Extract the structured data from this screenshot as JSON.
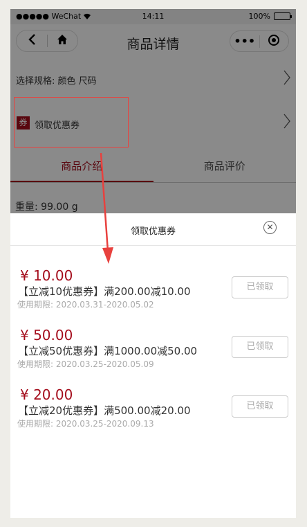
{
  "status_bar": {
    "carrier": "●●●●● WeChat",
    "time": "14:11",
    "battery": "100%",
    "battery_level": 1.0
  },
  "nav": {
    "title": "商品详情",
    "back_icon": "back-chevron-icon",
    "home_icon": "home-icon",
    "more_icon": "more-dots-icon",
    "close_icon": "target-close-icon"
  },
  "page": {
    "spec_label": "选择规格: 颜色 尺码",
    "coupon_tag": "券",
    "coupon_label": "领取优惠券",
    "tabs": [
      {
        "label": "商品介绍",
        "active": true
      },
      {
        "label": "商品评价",
        "active": false
      }
    ],
    "weight": "重量: 99.00 g"
  },
  "sheet": {
    "title": "领取优惠券",
    "coupons": [
      {
        "amount": "¥ 10.00",
        "name": "【立减10优惠券】满200.00减10.00",
        "date": "使用期限: 2020.03.31-2020.05.02",
        "button": "已领取"
      },
      {
        "amount": "¥ 50.00",
        "name": "【立减50优惠券】满1000.00减50.00",
        "date": "使用期限: 2020.03.25-2020.05.09",
        "button": "已领取"
      },
      {
        "amount": "¥ 20.00",
        "name": "【立减20优惠券】满500.00减20.00",
        "date": "使用期限: 2020.03.25-2020.09.13",
        "button": "已领取"
      }
    ]
  },
  "colors": {
    "accent": "#a50e1d",
    "annotation": "#e8413e"
  }
}
